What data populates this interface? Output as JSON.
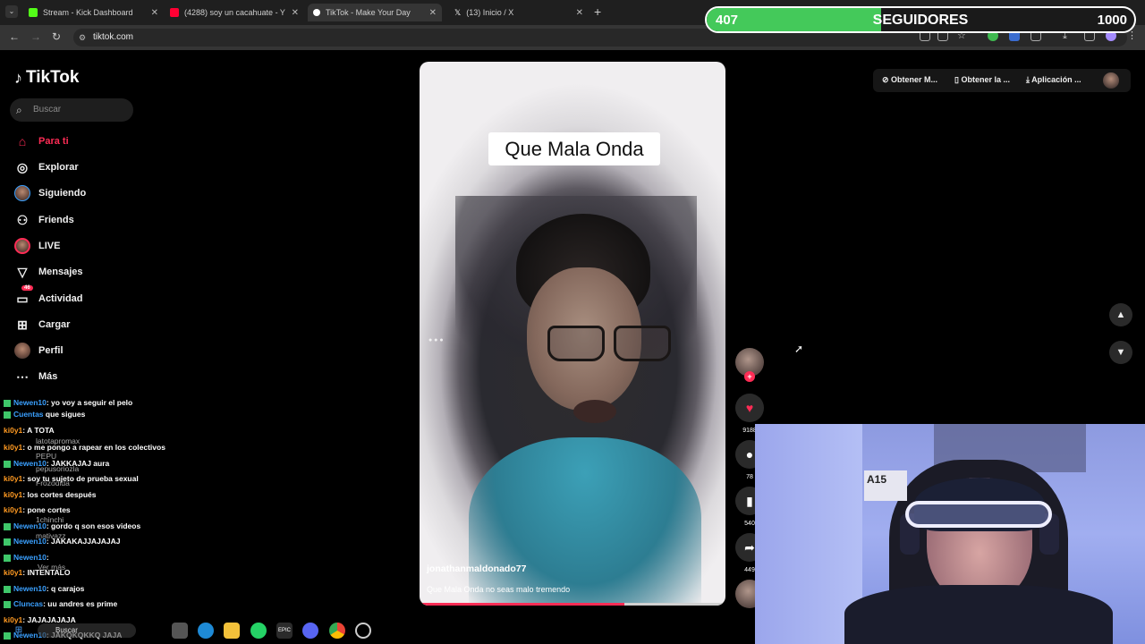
{
  "browser": {
    "tabs": [
      {
        "title": "Stream - Kick Dashboard",
        "color": "#53fc18"
      },
      {
        "title": "(4288) soy un cacahuate - Y",
        "color": "#ff0033"
      },
      {
        "title": "TikTok - Make Your Day",
        "color": "#111111"
      },
      {
        "title": "(13) Inicio / X",
        "color": "#ffffff"
      }
    ],
    "url": "tiktok.com"
  },
  "followers_goal": {
    "current": "407",
    "label": "SEGUIDORES",
    "goal": "1000",
    "progress": 0.407,
    "bar_color": "#44c95a"
  },
  "tiktok": {
    "logo": "TikTok",
    "search_placeholder": "Buscar",
    "menu": [
      {
        "label": "Para ti",
        "icon": "home-icon"
      },
      {
        "label": "Explorar",
        "icon": "compass-icon"
      },
      {
        "label": "Siguiendo",
        "icon": "following-icon"
      },
      {
        "label": "Friends",
        "icon": "friends-icon"
      },
      {
        "label": "LIVE",
        "icon": "live-icon"
      },
      {
        "label": "Mensajes",
        "icon": "send-icon"
      },
      {
        "label": "Actividad",
        "icon": "inbox-icon",
        "badge": "46"
      },
      {
        "label": "Cargar",
        "icon": "upload-icon"
      },
      {
        "label": "Perfil",
        "icon": "profile-avatar"
      },
      {
        "label": "Más",
        "icon": "more-icon"
      }
    ],
    "top_controls": {
      "get_coins": "Obtener M...",
      "get_app": "Obtener la ...",
      "desktop_app": "Aplicación ..."
    },
    "video": {
      "caption": "Que Mala Onda",
      "author": "jonathanmaldonado77",
      "description": "Que Mala Onda no seas malo tremendo",
      "progress": 0.67
    },
    "actions": {
      "likes": "9188",
      "comments": "78",
      "saves": "540",
      "shares": "449"
    }
  },
  "chat": {
    "lines": [
      {
        "user": "Newen10",
        "text": ": yo voy a seguir el pelo",
        "color": "u"
      },
      {
        "user": "Cuentas",
        "text": " que sigues",
        "color": "u"
      },
      {
        "user": "ki0y1",
        "text": ": A TOTA",
        "color": "u2"
      },
      {
        "user": "ki0y1",
        "text": ": o me pongo a rapear en los colectivos",
        "color": "u2"
      },
      {
        "user": "Newen10",
        "text": ": JAKKAJAJ aura",
        "color": "u"
      },
      {
        "user": "ki0y1",
        "text": ": soy tu sujeto de prueba sexual",
        "color": "u2"
      },
      {
        "user": "ki0y1",
        "text": ": los cortes después",
        "color": "u2"
      },
      {
        "user": "ki0y1",
        "text": ": pone cortes",
        "color": "u2"
      },
      {
        "user": "Newen10",
        "text": ": gordo q son esos videos",
        "color": "u"
      },
      {
        "user": "Newen10",
        "text": ": JAKAKAJJAJAJAJ",
        "color": "u"
      },
      {
        "user": "Newen10",
        "text": ": ",
        "color": "u"
      },
      {
        "user": "ki0y1",
        "text": ": INTENTALO",
        "color": "u2"
      },
      {
        "user": "Newen10",
        "text": ": q carajos",
        "color": "u"
      },
      {
        "user": "Cluncas",
        "text": ": uu andres es prime",
        "color": "u"
      },
      {
        "user": "ki0y1",
        "text": ": JAJAJAJAJA",
        "color": "u2"
      },
      {
        "user": "Newen10",
        "text": ": JAKQKQKKQ JAJA",
        "color": "u"
      }
    ],
    "ghost_accounts": [
      "latotapromax",
      "PEPU",
      "pepusoriozla",
      "Frozodida",
      "1chinchi",
      "mativazz",
      "Ver más"
    ]
  },
  "webcam": {
    "plate_text": "A15"
  },
  "taskbar": {
    "search": "Buscar"
  }
}
